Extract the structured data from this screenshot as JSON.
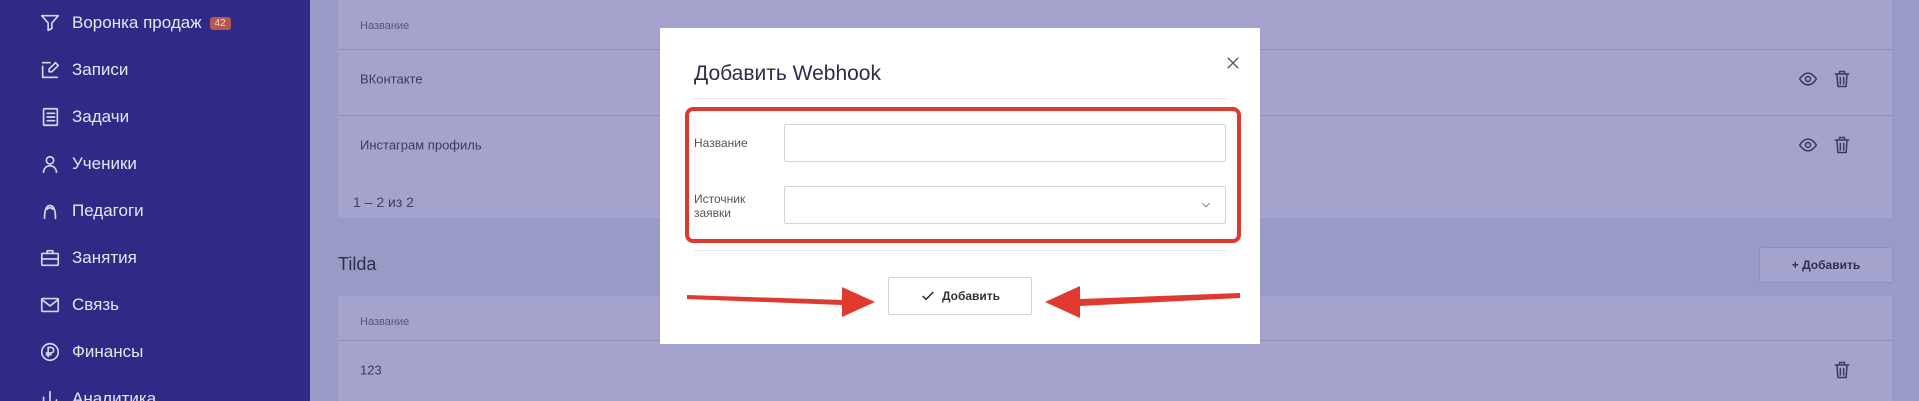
{
  "sidebar": {
    "items": [
      {
        "label": "Воронка продаж",
        "icon": "filter-icon",
        "badge": "42"
      },
      {
        "label": "Записи",
        "icon": "edit-icon"
      },
      {
        "label": "Задачи",
        "icon": "tasks-icon"
      },
      {
        "label": "Ученики",
        "icon": "user-icon"
      },
      {
        "label": "Педагоги",
        "icon": "teacher-icon"
      },
      {
        "label": "Занятия",
        "icon": "briefcase-icon"
      },
      {
        "label": "Связь",
        "icon": "mail-icon"
      },
      {
        "label": "Финансы",
        "icon": "finance-icon"
      },
      {
        "label": "Аналитика",
        "icon": "chart-icon"
      }
    ]
  },
  "table1": {
    "header": "Название",
    "rows": [
      "ВКонтакте",
      "Инстаграм профиль"
    ],
    "pager": "1 – 2 из 2"
  },
  "section2": {
    "title": "Tilda",
    "add_label": "+ Добавить",
    "header": "Название",
    "rows": [
      "123"
    ]
  },
  "modal": {
    "title": "Добавить Webhook",
    "name_label": "Название",
    "name_value": "",
    "source_label_line1": "Источник",
    "source_label_line2": "заявки",
    "source_value": "",
    "submit_label": "Добавить"
  },
  "colors": {
    "sidebar": "#2f2a86",
    "overlay": "#9a9ac6",
    "annotation": "#e03a30"
  }
}
